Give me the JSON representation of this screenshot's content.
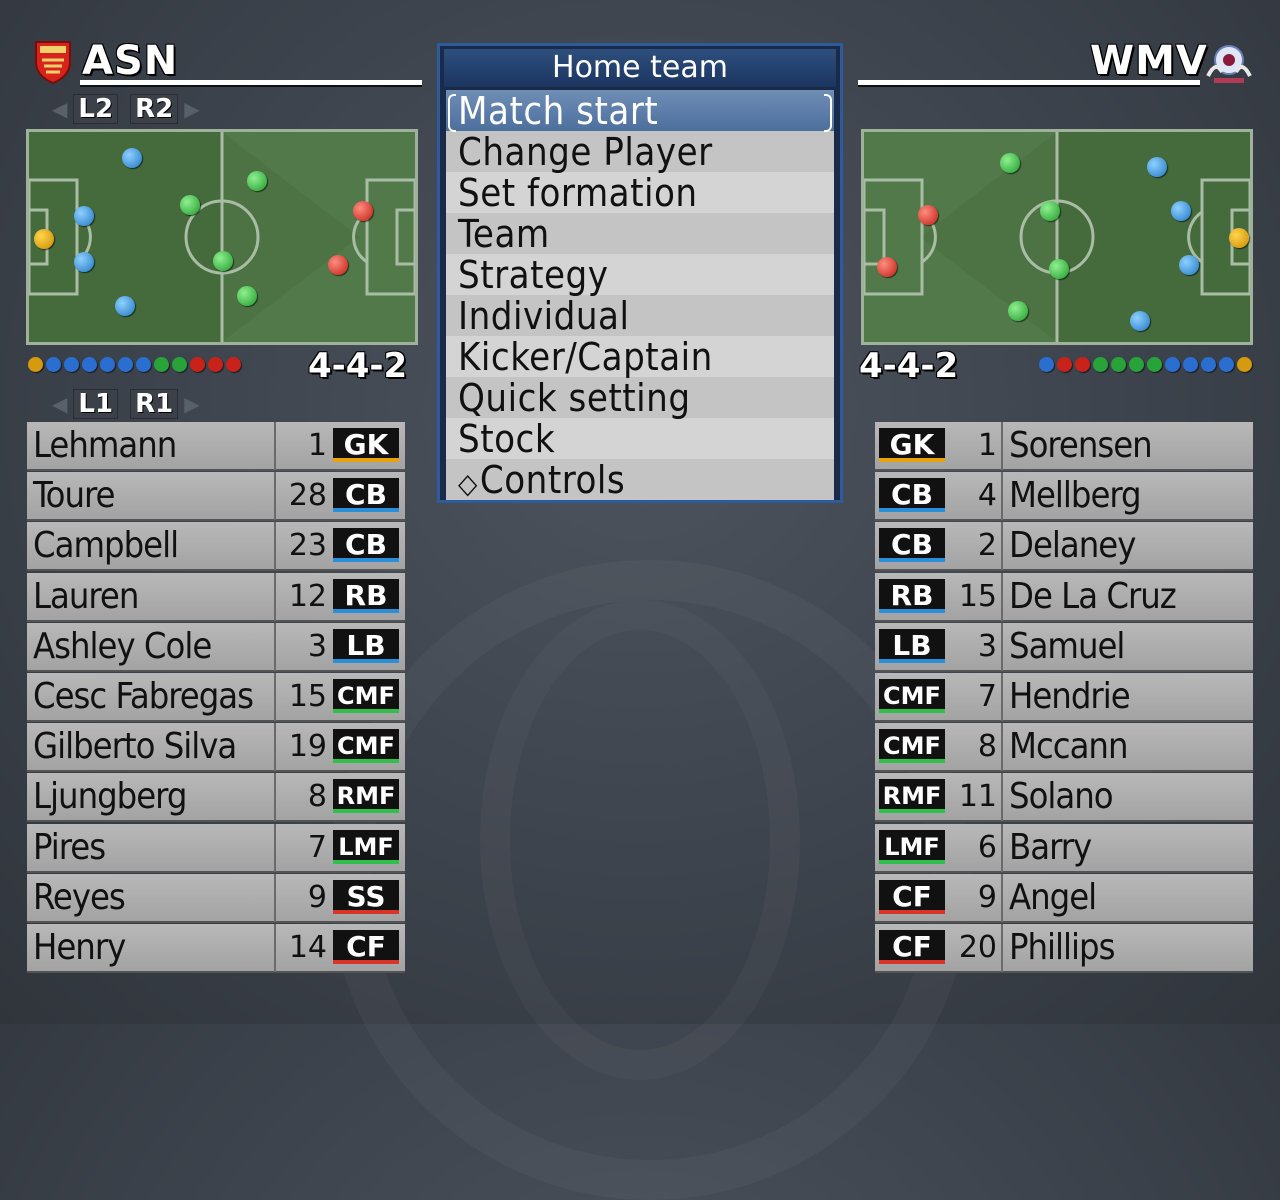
{
  "menu": {
    "title": "Home team",
    "items": [
      "Match start",
      "Change Player",
      "Set formation",
      "Team",
      "Strategy",
      "Individual",
      "Kicker/Captain",
      "Quick setting",
      "Stock",
      "Controls"
    ],
    "selected": "Match start"
  },
  "home": {
    "name": "ASN",
    "button_top_left": "L2",
    "button_top_right": "R2",
    "button_bottom_left": "L1",
    "button_bottom_right": "R1",
    "formation": "4-4-2",
    "players": [
      {
        "name": "Lehmann",
        "number": "1",
        "position": "GK"
      },
      {
        "name": "Toure",
        "number": "28",
        "position": "CB"
      },
      {
        "name": "Campbell",
        "number": "23",
        "position": "CB"
      },
      {
        "name": "Lauren",
        "number": "12",
        "position": "RB"
      },
      {
        "name": "Ashley Cole",
        "number": "3",
        "position": "LB"
      },
      {
        "name": "Cesc Fabregas",
        "number": "15",
        "position": "CMF"
      },
      {
        "name": "Gilberto Silva",
        "number": "19",
        "position": "CMF"
      },
      {
        "name": "Ljungberg",
        "number": "8",
        "position": "RMF"
      },
      {
        "name": "Pires",
        "number": "7",
        "position": "LMF"
      },
      {
        "name": "Reyes",
        "number": "9",
        "position": "SS"
      },
      {
        "name": "Henry",
        "number": "14",
        "position": "CF"
      }
    ]
  },
  "away": {
    "name": "WMV",
    "formation": "4-4-2",
    "players": [
      {
        "name": "Sorensen",
        "number": "1",
        "position": "GK"
      },
      {
        "name": "Mellberg",
        "number": "4",
        "position": "CB"
      },
      {
        "name": "Delaney",
        "number": "2",
        "position": "CB"
      },
      {
        "name": "De La Cruz",
        "number": "15",
        "position": "RB"
      },
      {
        "name": "Samuel",
        "number": "3",
        "position": "LB"
      },
      {
        "name": "Hendrie",
        "number": "7",
        "position": "CMF"
      },
      {
        "name": "Mccann",
        "number": "8",
        "position": "CMF"
      },
      {
        "name": "Solano",
        "number": "11",
        "position": "RMF"
      },
      {
        "name": "Barry",
        "number": "6",
        "position": "LMF"
      },
      {
        "name": "Angel",
        "number": "9",
        "position": "CF"
      },
      {
        "name": "Phillips",
        "number": "20",
        "position": "CF"
      }
    ]
  },
  "colors": {
    "gk": "#e8a20a",
    "defender": "#2a8fd8",
    "midfielder": "#2fbf4a",
    "forward": "#d8342a"
  }
}
